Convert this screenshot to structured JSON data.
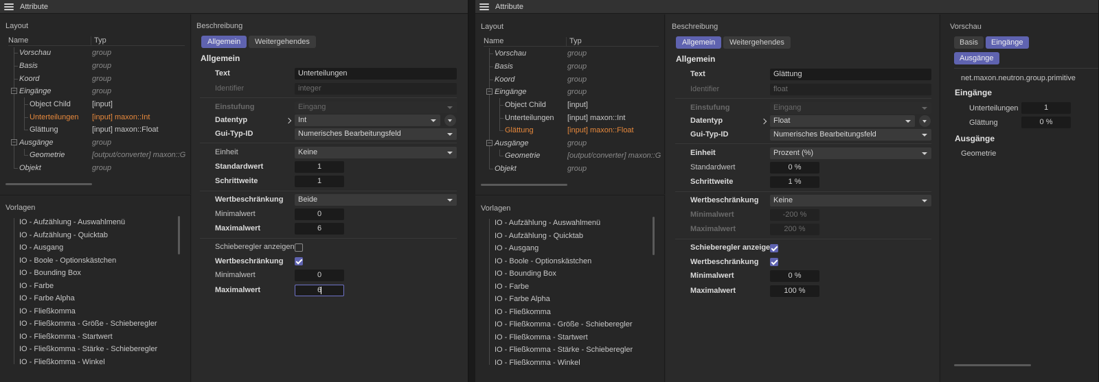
{
  "left_window": {
    "title": "Attribute",
    "layout": {
      "label": "Layout",
      "col_name": "Name",
      "col_type": "Typ",
      "rows": [
        {
          "name": "Vorschau",
          "type": "group"
        },
        {
          "name": "Basis",
          "type": "group"
        },
        {
          "name": "Koord",
          "type": "group"
        },
        {
          "name": "Eingänge",
          "type": "group"
        },
        {
          "name": "Object Child",
          "type": "[input]"
        },
        {
          "name": "Unterteilungen",
          "type": "[input] maxon::Int"
        },
        {
          "name": "Glättung",
          "type": "[input] maxon::Float"
        },
        {
          "name": "Ausgänge",
          "type": "group"
        },
        {
          "name": "Geometrie",
          "type": "[output/converter] maxon::G"
        },
        {
          "name": "Objekt",
          "type": "group"
        }
      ]
    },
    "templates": {
      "label": "Vorlagen",
      "items": [
        "IO - Aufzählung - Auswahlmenü",
        "IO - Aufzählung - Quicktab",
        "IO - Ausgang",
        "IO - Boole - Optionskästchen",
        "IO - Bounding Box",
        "IO - Farbe",
        "IO - Farbe Alpha",
        "IO - Fließkomma",
        "IO - Fließkomma - Größe - Schieberegler",
        "IO - Fließkomma - Startwert",
        "IO - Fließkomma - Stärke - Schieberegler",
        "IO - Fließkomma - Winkel"
      ]
    },
    "desc": {
      "label": "Beschreibung",
      "tab_general": "Allgemein",
      "tab_advanced": "Weitergehendes",
      "group_title": "Allgemein",
      "text_label": "Text",
      "text_value": "Unterteilungen",
      "identifier_label": "Identifier",
      "identifier_value": "integer",
      "classification_label": "Einstufung",
      "classification_value": "Eingang",
      "datatype_label": "Datentyp",
      "datatype_value": "Int",
      "guitype_label": "Gui-Typ-ID",
      "guitype_value": "Numerisches Bearbeitungsfeld",
      "unit_label": "Einheit",
      "unit_value": "Keine",
      "default_label": "Standardwert",
      "default_value": "1",
      "step_label": "Schrittweite",
      "step_value": "1",
      "limit_label": "Wertbeschränkung",
      "limit_value": "Beide",
      "min_label": "Minimalwert",
      "min_value": "0",
      "max_label": "Maximalwert",
      "max_value": "6",
      "slider_label": "Schieberegler anzeigen",
      "limit2_label": "Wertbeschränkung",
      "min2_label": "Minimalwert",
      "min2_value": "0",
      "max2_label": "Maximalwert",
      "max2_value": "6"
    }
  },
  "right_window": {
    "title": "Attribute",
    "layout": {
      "label": "Layout",
      "col_name": "Name",
      "col_type": "Typ",
      "rows": [
        {
          "name": "Vorschau",
          "type": "group"
        },
        {
          "name": "Basis",
          "type": "group"
        },
        {
          "name": "Koord",
          "type": "group"
        },
        {
          "name": "Eingänge",
          "type": "group"
        },
        {
          "name": "Object Child",
          "type": "[input]"
        },
        {
          "name": "Unterteilungen",
          "type": "[input] maxon::Int"
        },
        {
          "name": "Glättung",
          "type": "[input] maxon::Float"
        },
        {
          "name": "Ausgänge",
          "type": "group"
        },
        {
          "name": "Geometrie",
          "type": "[output/converter] maxon::G"
        },
        {
          "name": "Objekt",
          "type": "group"
        }
      ]
    },
    "templates": {
      "label": "Vorlagen",
      "items": [
        "IO - Aufzählung - Auswahlmenü",
        "IO - Aufzählung - Quicktab",
        "IO - Ausgang",
        "IO - Boole - Optionskästchen",
        "IO - Bounding Box",
        "IO - Farbe",
        "IO - Farbe Alpha",
        "IO - Fließkomma",
        "IO - Fließkomma - Größe - Schieberegler",
        "IO - Fließkomma - Startwert",
        "IO - Fließkomma - Stärke - Schieberegler",
        "IO - Fließkomma - Winkel"
      ]
    },
    "desc": {
      "label": "Beschreibung",
      "tab_general": "Allgemein",
      "tab_advanced": "Weitergehendes",
      "group_title": "Allgemein",
      "text_label": "Text",
      "text_value": "Glättung",
      "identifier_label": "Identifier",
      "identifier_value": "float",
      "classification_label": "Einstufung",
      "classification_value": "Eingang",
      "datatype_label": "Datentyp",
      "datatype_value": "Float",
      "guitype_label": "Gui-Typ-ID",
      "guitype_value": "Numerisches Bearbeitungsfeld",
      "unit_label": "Einheit",
      "unit_value": "Prozent (%)",
      "default_label": "Standardwert",
      "default_value": "0 %",
      "step_label": "Schrittweite",
      "step_value": "1 %",
      "limit_label": "Wertbeschränkung",
      "limit_value": "Keine",
      "min_label": "Minimalwert",
      "min_value": "-200 %",
      "max_label": "Maximalwert",
      "max_value": "200 %",
      "slider_label": "Schieberegler anzeigen",
      "limit2_label": "Wertbeschränkung",
      "min2_label": "Minimalwert",
      "min2_value": "0 %",
      "max2_label": "Maximalwert",
      "max2_value": "100 %"
    },
    "preview": {
      "label": "Vorschau",
      "tab_basis": "Basis",
      "tab_inputs": "Eingänge",
      "tab_outputs": "Ausgänge",
      "path": "net.maxon.neutron.group.primitive",
      "inputs_title": "Eingänge",
      "subdivisions_label": "Unterteilungen",
      "subdivisions_value": "1",
      "smoothing_label": "Glättung",
      "smoothing_value": "0 %",
      "outputs_title": "Ausgänge",
      "geometry_label": "Geometrie"
    }
  }
}
